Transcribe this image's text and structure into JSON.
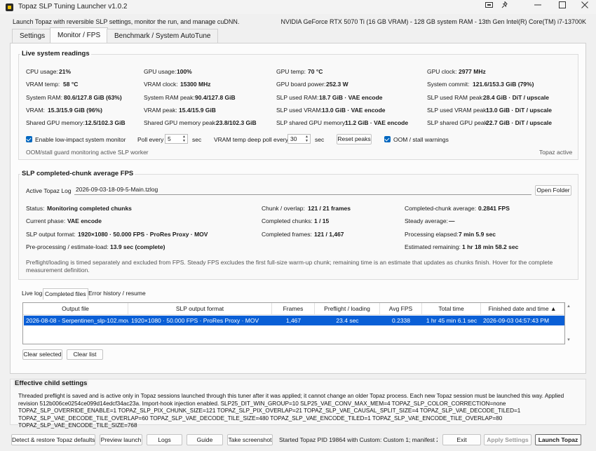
{
  "window": {
    "title": "Topaz SLP Tuning Launcher v1.0.2",
    "controls": [
      "minimize-icon",
      "maximize-icon",
      "close-icon"
    ]
  },
  "header": {
    "subtitle": "Launch Topaz with reversible SLP settings, monitor the run, and manage cuDNN.",
    "system_info": "NVIDIA GeForce RTX 5070 Ti (16 GB VRAM) - 128 GB system RAM - 13th Gen Intel(R) Core(TM) i7-13700K"
  },
  "tabs": [
    {
      "label": "Settings"
    },
    {
      "label": "Monitor / FPS"
    },
    {
      "label": "Benchmark / System AutoTune"
    }
  ],
  "live": {
    "title": "Live system readings",
    "readings": [
      {
        "label": "CPU usage:",
        "value": "21%"
      },
      {
        "label": "GPU usage:",
        "value": "100%"
      },
      {
        "label": "GPU temp:",
        "value": "70 °C"
      },
      {
        "label": "GPU clock:",
        "value": "2977 MHz"
      },
      {
        "label": "VRAM temp:",
        "value": "58 °C"
      },
      {
        "label": "VRAM clock:",
        "value": "15300 MHz"
      },
      {
        "label": "GPU board power:",
        "value": "252.3 W"
      },
      {
        "label": "System commit:",
        "value": "121.6/153.3 GiB (79%)"
      },
      {
        "label": "System RAM:",
        "value": "80.6/127.8 GiB (63%)"
      },
      {
        "label": "System RAM peak:",
        "value": "90.4/127.8 GiB"
      },
      {
        "label": "SLP used RAM:",
        "value": "18.7 GiB · VAE encode"
      },
      {
        "label": "SLP used RAM peak:",
        "value": "28.4 GiB · DiT / upscale"
      },
      {
        "label": "VRAM:",
        "value": "15.3/15.9 GiB (96%)"
      },
      {
        "label": "VRAM peak:",
        "value": "15.4/15.9 GiB"
      },
      {
        "label": "SLP used VRAM:",
        "value": "13.0 GiB · VAE encode"
      },
      {
        "label": "SLP used VRAM peak:",
        "value": "13.0 GiB · DiT / upscale"
      },
      {
        "label": "Shared GPU memory:",
        "value": "12.5/102.3 GiB"
      },
      {
        "label": "Shared GPU memory peak:",
        "value": "23.8/102.3 GiB"
      },
      {
        "label": "SLP shared GPU memory:",
        "value": "11.2 GiB · VAE encode"
      },
      {
        "label": "SLP shared GPU peak:",
        "value": "22.7 GiB · DiT / upscale"
      }
    ],
    "low_impact_label": "Enable low-impact system monitor",
    "poll_label": "Poll every",
    "poll_value": "5",
    "poll_unit": "sec",
    "deep_poll_label": "VRAM temp deep poll every",
    "deep_poll_value": "30",
    "deep_poll_unit": "sec",
    "reset_peaks": "Reset peaks",
    "oom_label": "OOM / stall warnings",
    "guard_status": "OOM/stall guard monitoring active SLP worker",
    "topaz_status": "Topaz active"
  },
  "fps": {
    "title": "SLP completed-chunk average FPS",
    "active_log_label": "Active Topaz Log",
    "active_log_value": "2026-09-03-18-09-5-Main.tzlog",
    "open_folder": "Open Folder",
    "col1": [
      {
        "label": "Status:",
        "value": "Monitoring completed chunks"
      },
      {
        "label": "Current phase:",
        "value": "VAE encode"
      },
      {
        "label": "SLP output format:",
        "value": "1920×1080 · 50.000 FPS · ProRes Proxy · MOV"
      },
      {
        "label": "Pre-processing / estimate-load:",
        "value": "13.9 sec (complete)"
      }
    ],
    "col2": [
      {
        "label": "Chunk / overlap:",
        "value": "121 / 21 frames"
      },
      {
        "label": "Completed chunks:",
        "value": "1 / 15"
      },
      {
        "label": "Completed frames:",
        "value": "121 / 1,467"
      }
    ],
    "col3": [
      {
        "label": "Completed-chunk average:",
        "value": "0.2841 FPS"
      },
      {
        "label": "Steady average:",
        "value": "—"
      },
      {
        "label": "Processing elapsed:",
        "value": "7 min 5.9 sec"
      },
      {
        "label": "Estimated remaining:",
        "value": "1 hr 18 min 58.2 sec"
      }
    ],
    "note": "Preflight/loading is timed separately and excluded from FPS. Steady FPS excludes the first full-size warm-up chunk; remaining time is an estimate that updates as chunks finish. Hover for the complete measurement definition."
  },
  "log_tabs": [
    {
      "label": "Live log"
    },
    {
      "label": "Completed files"
    },
    {
      "label": "Error history / resume"
    }
  ],
  "table": {
    "headers": [
      "Output file",
      "SLP output format",
      "Frames",
      "Preflight / loading",
      "Avg FPS",
      "Total time",
      "Finished date and time ▲"
    ],
    "rows": [
      [
        "2026-08-08 - Serpentinen_slp-102.mov",
        "1920×1080 · 50.000 FPS · ProRes Proxy · MOV",
        "1,467",
        "23.4 sec",
        "0.2338",
        "1 hr 45 min 6.1 sec",
        "2026-09-03 04:57:43 PM"
      ]
    ],
    "clear_selected": "Clear selected",
    "clear_list": "Clear list"
  },
  "effective": {
    "title": "Effective child settings",
    "text": "Threaded preflight is saved and is active only in Topaz sessions launched through this tuner after it was applied; it cannot change an older Topaz process. Each new Topaz session must be launched this way. Applied revision 512b006ce0254ce099d14edcf34ac23a. Import-hook injection enabled. SLP25_DIT_WIN_GROUP=10  SLP25_VAE_CONV_MAX_MEM=4  TOPAZ_SLP_COLOR_CORRECTION=none  TOPAZ_SLP_OVERRIDE_ENABLE=1  TOPAZ_SLP_PIX_CHUNK_SIZE=121  TOPAZ_SLP_PIX_OVERLAP=21  TOPAZ_SLP_VAE_CAUSAL_SPLIT_SIZE=4  TOPAZ_SLP_VAE_DECODE_TILED=1  TOPAZ_SLP_VAE_DECODE_TILE_OVERLAP=60  TOPAZ_SLP_VAE_DECODE_TILE_SIZE=480  TOPAZ_SLP_VAE_ENCODE_TILED=1  TOPAZ_SLP_VAE_ENCODE_TILE_OVERLAP=80  TOPAZ_SLP_VAE_ENCODE_TILE_SIZE=768"
  },
  "bottom": {
    "detect": "Detect & restore Topaz defaults",
    "preview": "Preview launch",
    "logs": "Logs",
    "guide": "Guide",
    "screenshot": "Take screenshot",
    "status": "Started Topaz PID 19864 with Custom: Custom 1; manifest 202",
    "exit": "Exit",
    "apply": "Apply Settings",
    "launch": "Launch Topaz"
  },
  "colors": {
    "accent": "#0067c0",
    "selection": "#0a5fd6"
  }
}
